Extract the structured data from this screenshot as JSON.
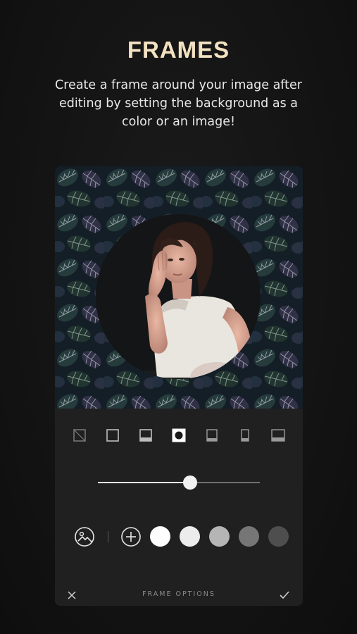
{
  "header": {
    "title": "FRAMES",
    "subtitle": "Create a frame around your image after editing by setting the background as a color or an image!"
  },
  "preview": {
    "background": "leaf-pattern-image",
    "frame_shape": "circle",
    "photo": "woman-portrait"
  },
  "frame_options": [
    {
      "name": "none",
      "icon": "frame-none-icon",
      "selected": false
    },
    {
      "name": "square",
      "icon": "frame-square-icon",
      "selected": false
    },
    {
      "name": "top-band",
      "icon": "frame-top-band-icon",
      "selected": false
    },
    {
      "name": "circle",
      "icon": "frame-circle-icon",
      "selected": true
    },
    {
      "name": "bottom-band-wide",
      "icon": "frame-bottom-band-icon",
      "selected": false
    },
    {
      "name": "bottom-band-narrow",
      "icon": "frame-bottom-narrow-icon",
      "selected": false
    },
    {
      "name": "bottom-band-full",
      "icon": "frame-bottom-full-icon",
      "selected": false
    }
  ],
  "slider": {
    "value": 0.57
  },
  "colors": {
    "image_button_icon": "image-background-icon",
    "add_button_icon": "add-color-icon",
    "swatches": [
      "#ffffff",
      "#ececec",
      "#b5b5b5",
      "#767676",
      "#4e4e4e"
    ],
    "accent_text": "#f3e2c2"
  },
  "bottom_bar": {
    "label": "FRAME OPTIONS",
    "cancel_icon": "close-icon",
    "confirm_icon": "check-icon"
  }
}
